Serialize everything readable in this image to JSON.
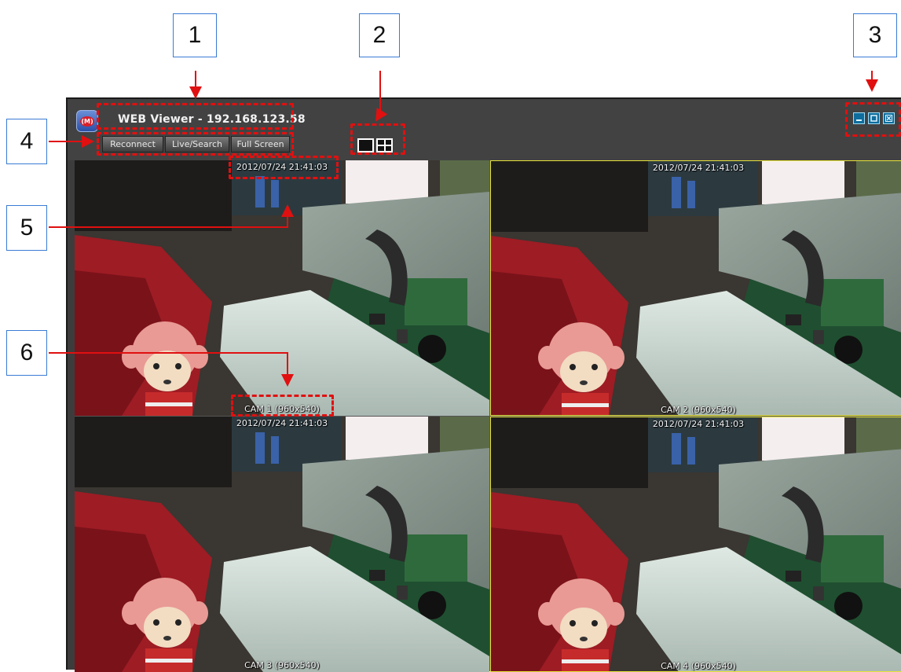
{
  "callouts": [
    "1",
    "2",
    "3",
    "4",
    "5",
    "6"
  ],
  "window": {
    "title": "WEB Viewer - 192.168.123.58",
    "logo_icon": "app-logo-icon",
    "logo_text": "(M)",
    "buttons": [
      "Reconnect",
      "Live/Search",
      "Full Screen"
    ],
    "layout_buttons": [
      "single-view-icon",
      "quad-view-icon"
    ],
    "window_controls": [
      "minimize-icon",
      "maximize-icon",
      "close-icon"
    ]
  },
  "cameras": [
    {
      "timestamp": "2012/07/24  21:41:03",
      "label": "CAM 1 (960x540)"
    },
    {
      "timestamp": "2012/07/24  21:41:03",
      "label": "CAM 2 (960x540)"
    },
    {
      "timestamp": "2012/07/24  21:41:03",
      "label": "CAM 3 (960x540)"
    },
    {
      "timestamp": "2012/07/24  21:41:03",
      "label": "CAM 4 (960x540)"
    }
  ],
  "colors": {
    "annotation_red": "#e01010",
    "callout_border": "#3a7bd5",
    "active_cell_border": "#e6e23a",
    "window_bg": "#3c3c3c"
  }
}
